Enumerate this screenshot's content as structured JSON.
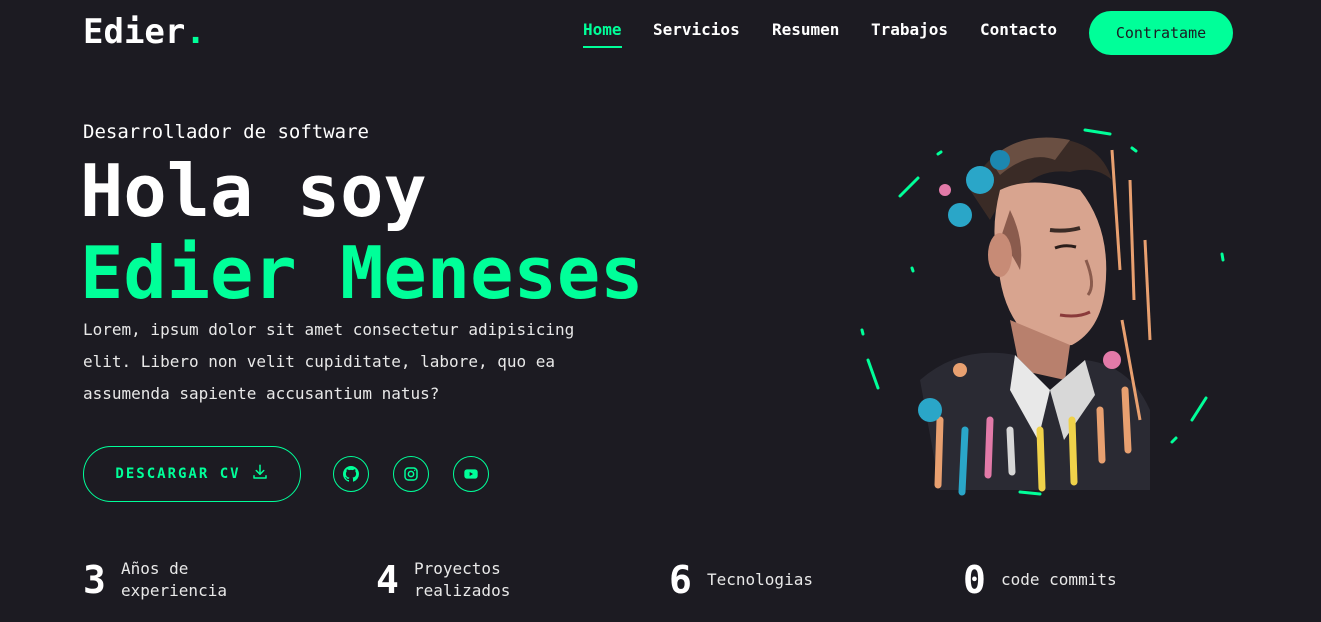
{
  "logo": {
    "text": "Edier",
    "dot": "."
  },
  "nav": {
    "items": [
      {
        "label": "Home",
        "active": true
      },
      {
        "label": "Servicios",
        "active": false
      },
      {
        "label": "Resumen",
        "active": false
      },
      {
        "label": "Trabajos",
        "active": false
      },
      {
        "label": "Contacto",
        "active": false
      }
    ],
    "hire_label": "Contratame"
  },
  "hero": {
    "subtitle": "Desarrollador de software",
    "greeting": "Hola soy",
    "name": "Edier Meneses",
    "description": "Lorem, ipsum dolor sit amet consectetur adipisicing elit. Libero non velit cupiditate, labore, quo ea assumenda sapiente accusantium natus?",
    "cv_label": "DESCARGAR CV",
    "social": [
      {
        "icon": "github-icon"
      },
      {
        "icon": "instagram-icon"
      },
      {
        "icon": "youtube-icon"
      }
    ]
  },
  "stats": [
    {
      "value": "3",
      "label": "Años de experiencia"
    },
    {
      "value": "4",
      "label": "Proyectos realizados"
    },
    {
      "value": "6",
      "label": "Tecnologias"
    },
    {
      "value": "0",
      "label": "code commits"
    }
  ],
  "colors": {
    "accent": "#00ff99",
    "background": "#1c1b22",
    "text": "#ffffff"
  }
}
